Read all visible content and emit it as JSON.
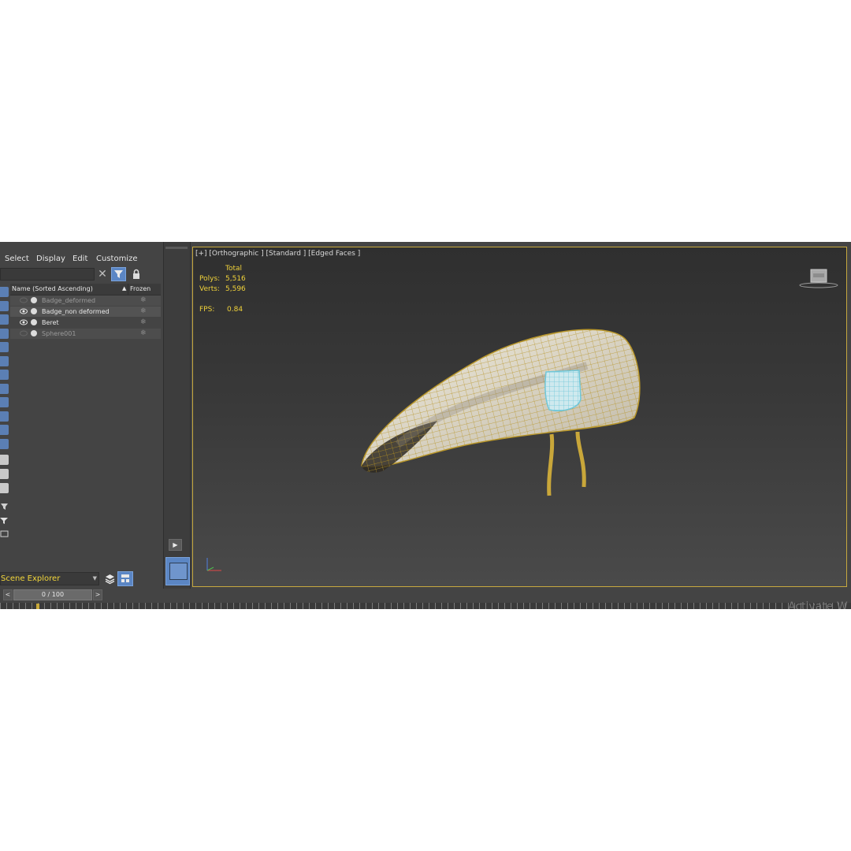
{
  "menu": {
    "select": "Select",
    "display": "Display",
    "edit": "Edit",
    "customize": "Customize"
  },
  "explorer": {
    "header_name": "Name (Sorted Ascending)",
    "header_frozen": "Frozen",
    "rows": [
      {
        "label": "Badge_deformed",
        "visible": false
      },
      {
        "label": "Badge_non deformed",
        "visible": true
      },
      {
        "label": "Beret",
        "visible": true
      },
      {
        "label": "Sphere001",
        "visible": false
      }
    ],
    "dropdown": "Scene Explorer"
  },
  "viewport": {
    "label": "[+] [Orthographic ] [Standard ] [Edged Faces ]",
    "stats": {
      "total": "Total",
      "polys_label": "Polys:",
      "polys": "5,516",
      "verts_label": "Verts:",
      "verts": "5,596",
      "fps_label": "FPS:",
      "fps": "0.84"
    }
  },
  "timeline": {
    "frame": "0 / 100",
    "prev": "<",
    "next": ">"
  },
  "watermark": "Activate W",
  "colors": {
    "accent": "#5b86c4",
    "stats": "#f0d23a",
    "frame_border": "#c7a93f",
    "wire": "#b8962a"
  }
}
